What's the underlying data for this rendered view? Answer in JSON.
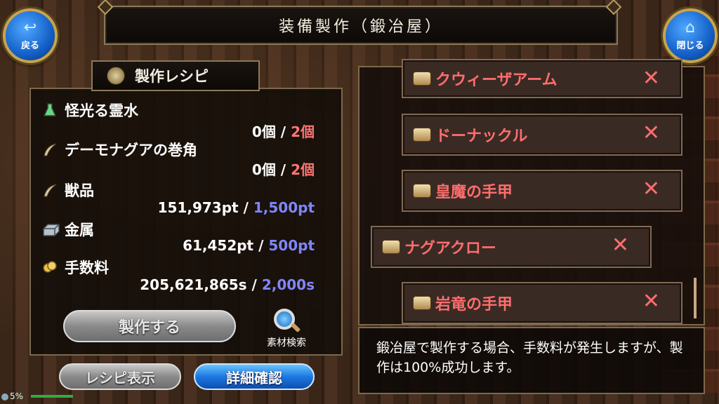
{
  "window": {
    "title": "装備製作（鍛冶屋）"
  },
  "nav": {
    "back": {
      "label": "戻る",
      "icon": "back-arrow-icon"
    },
    "close": {
      "label": "閉じる",
      "icon": "home-icon"
    }
  },
  "recipe": {
    "heading": "製作レシピ",
    "materials": [
      {
        "name": "怪光る霊水",
        "owned": "0個",
        "sep": "/",
        "required": "2個",
        "icon": "flask-icon",
        "req_color": "red"
      },
      {
        "name": "デーモナグアの巻角",
        "owned": "0個",
        "sep": "/",
        "required": "2個",
        "icon": "horn-icon",
        "req_color": "red"
      },
      {
        "name": "獣品",
        "owned": "151,973pt",
        "sep": "/",
        "required": "1,500pt",
        "icon": "horn-icon",
        "req_color": "blue"
      },
      {
        "name": "金属",
        "owned": "61,452pt",
        "sep": "/",
        "required": "500pt",
        "icon": "ingot-icon",
        "req_color": "blue"
      },
      {
        "name": "手数料",
        "owned": "205,621,865s",
        "sep": "/",
        "required": "2,000s",
        "icon": "coins-icon",
        "req_color": "blue"
      }
    ],
    "craft_button": "製作する",
    "search_label": "素材検索"
  },
  "bottom_buttons": {
    "recipe_show": "レシピ表示",
    "detail_confirm": "詳細確認"
  },
  "equipment_list": [
    {
      "name": "クウィーザアーム",
      "selected": false
    },
    {
      "name": "ドーナックル",
      "selected": false
    },
    {
      "name": "皇魔の手甲",
      "selected": false
    },
    {
      "name": "ナグアクロー",
      "selected": true
    },
    {
      "name": "岩竜の手甲",
      "selected": false
    }
  ],
  "remove_mark": "✕",
  "message": "鍛冶屋で製作する場合、手数料が発生しますが、製作は100%成功します。",
  "status": {
    "battery": "5%"
  },
  "colors": {
    "required_red": "#ff7777",
    "required_blue": "#7f86ff",
    "item_name": "#ff6e6e",
    "button_blue": "#1c78e0"
  }
}
